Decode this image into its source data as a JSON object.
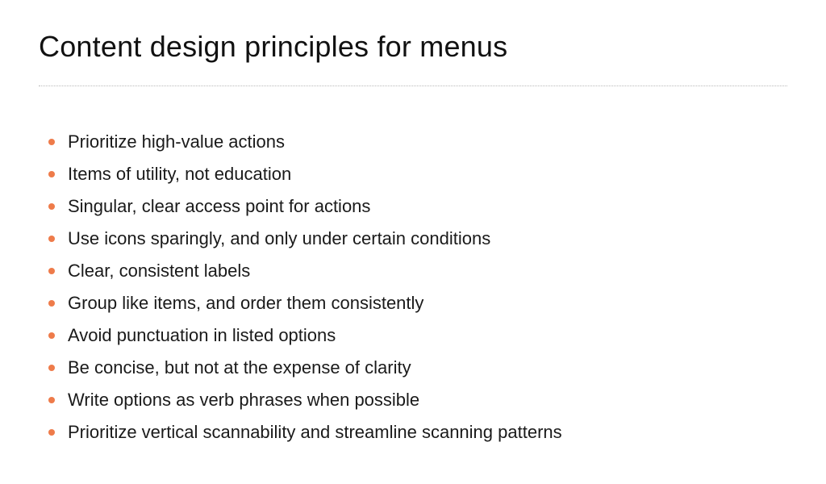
{
  "page": {
    "title": "Content design principles for menus",
    "bullet_color": "#ee7b4a",
    "items": [
      "Prioritize high-value actions",
      "Items of utility, not education",
      "Singular, clear access point for actions",
      "Use icons sparingly, and only under certain conditions",
      "Clear, consistent labels",
      "Group like items, and order them consistently",
      "Avoid punctuation in listed options",
      "Be concise, but not at the expense of clarity",
      "Write options as verb phrases when possible",
      "Prioritize vertical scannability and streamline scanning patterns"
    ]
  }
}
